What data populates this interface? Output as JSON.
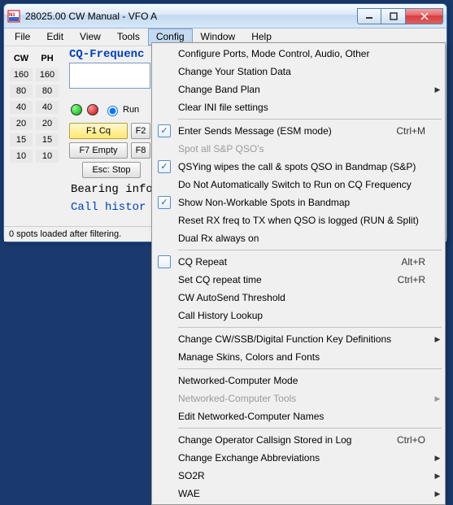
{
  "window": {
    "title": "28025.00 CW Manual - VFO A"
  },
  "menu": {
    "items": [
      "File",
      "Edit",
      "View",
      "Tools",
      "Config",
      "Window",
      "Help"
    ],
    "open_index": 4
  },
  "bands": {
    "headers": [
      "CW",
      "PH"
    ],
    "rows": [
      [
        "160",
        "160"
      ],
      [
        "80",
        "80"
      ],
      [
        "40",
        "40"
      ],
      [
        "20",
        "20"
      ],
      [
        "15",
        "15"
      ],
      [
        "10",
        "10"
      ]
    ]
  },
  "cq": {
    "label": "CQ-Frequenc",
    "value": "",
    "run_label": "Run"
  },
  "buttons": {
    "f1": "F1 Cq",
    "f2": "F2",
    "f7": "F7 Empty",
    "f8": "F8",
    "esc": "Esc: Stop"
  },
  "info": {
    "bearing": "Bearing info",
    "callhist": "Call histor"
  },
  "status": {
    "text": "0 spots loaded after filtering."
  },
  "config_menu": [
    {
      "kind": "item",
      "label": "Configure Ports, Mode Control, Audio, Other"
    },
    {
      "kind": "item",
      "label": "Change Your Station Data"
    },
    {
      "kind": "submenu",
      "label": "Change Band Plan"
    },
    {
      "kind": "item",
      "label": "Clear INI file settings"
    },
    {
      "kind": "sep"
    },
    {
      "kind": "check",
      "checked": true,
      "label": "Enter Sends Message (ESM mode)",
      "accel": "Ctrl+M"
    },
    {
      "kind": "item",
      "disabled": true,
      "label": "Spot all S&P QSO's"
    },
    {
      "kind": "check",
      "checked": true,
      "label": "QSYing wipes the call & spots QSO in Bandmap (S&P)"
    },
    {
      "kind": "item",
      "label": "Do Not Automatically Switch to Run on CQ Frequency"
    },
    {
      "kind": "check",
      "checked": true,
      "label": "Show Non-Workable Spots in Bandmap"
    },
    {
      "kind": "item",
      "label": "Reset RX freq to TX when QSO is logged (RUN & Split)"
    },
    {
      "kind": "item",
      "label": "Dual Rx always on"
    },
    {
      "kind": "sep"
    },
    {
      "kind": "check",
      "checked": false,
      "label": "CQ Repeat",
      "accel": "Alt+R"
    },
    {
      "kind": "item",
      "label": "Set CQ repeat time",
      "accel": "Ctrl+R"
    },
    {
      "kind": "item",
      "label": "CW AutoSend Threshold"
    },
    {
      "kind": "item",
      "label": "Call History Lookup"
    },
    {
      "kind": "sep"
    },
    {
      "kind": "submenu",
      "label": "Change CW/SSB/Digital Function Key Definitions"
    },
    {
      "kind": "item",
      "label": "Manage Skins, Colors and Fonts"
    },
    {
      "kind": "sep"
    },
    {
      "kind": "item",
      "label": "Networked-Computer Mode"
    },
    {
      "kind": "submenu",
      "disabled": true,
      "label": "Networked-Computer Tools"
    },
    {
      "kind": "item",
      "label": "Edit Networked-Computer Names"
    },
    {
      "kind": "sep"
    },
    {
      "kind": "item",
      "label": "Change Operator Callsign Stored in Log",
      "accel": "Ctrl+O"
    },
    {
      "kind": "submenu",
      "label": "Change Exchange Abbreviations"
    },
    {
      "kind": "submenu",
      "label": "SO2R"
    },
    {
      "kind": "submenu",
      "label": "WAE"
    }
  ]
}
